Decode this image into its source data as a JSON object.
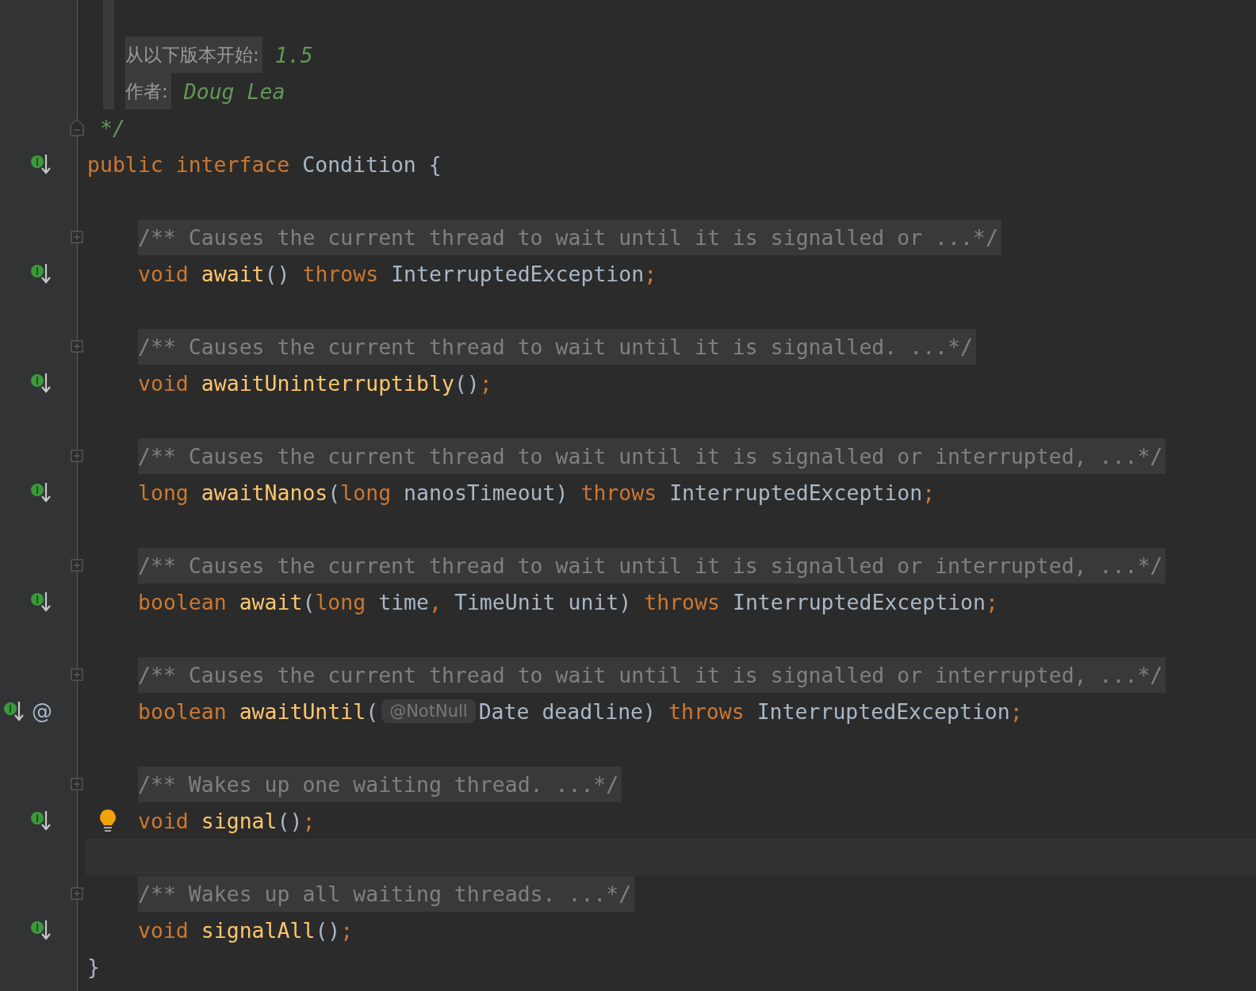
{
  "editor": {
    "lines": [
      {
        "kind": "doc"
      },
      {
        "kind": "doc",
        "label": "从以下版本开始:",
        "value": "1.5"
      },
      {
        "kind": "doc",
        "label": "作者:",
        "value": "Doug Lea"
      },
      {
        "kind": "doc_close",
        "text": "*/",
        "fold_end": true
      },
      {
        "kind": "code",
        "implements": true,
        "tokens": [
          {
            "kind": "keyword",
            "text": "public "
          },
          {
            "kind": "keyword",
            "text": "interface "
          },
          {
            "kind": "plain",
            "text": "Condition {"
          }
        ],
        "children": [
          {
            "kind": "blank"
          },
          {
            "kind": "comment",
            "text": "/** Causes the current thread to wait until it is signalled or ...*/",
            "folded": true
          },
          {
            "kind": "code",
            "implements": true,
            "tokens": [
              {
                "kind": "keyword",
                "text": "void "
              },
              {
                "kind": "method",
                "text": "await"
              },
              {
                "kind": "plain",
                "text": "() "
              },
              {
                "kind": "keyword",
                "text": "throws "
              },
              {
                "kind": "plain",
                "text": "InterruptedException"
              },
              {
                "kind": "keyword",
                "text": ";"
              }
            ]
          },
          {
            "kind": "blank"
          },
          {
            "kind": "comment",
            "text": "/** Causes the current thread to wait until it is signalled. ...*/",
            "folded": true
          },
          {
            "kind": "code",
            "implements": true,
            "tokens": [
              {
                "kind": "keyword",
                "text": "void "
              },
              {
                "kind": "method",
                "text": "awaitUninterruptibly"
              },
              {
                "kind": "plain",
                "text": "()"
              },
              {
                "kind": "keyword",
                "text": ";"
              }
            ]
          },
          {
            "kind": "blank"
          },
          {
            "kind": "comment",
            "text": "/** Causes the current thread to wait until it is signalled or interrupted, ...*/",
            "folded": true
          },
          {
            "kind": "code",
            "implements": true,
            "tokens": [
              {
                "kind": "keyword",
                "text": "long "
              },
              {
                "kind": "method",
                "text": "awaitNanos"
              },
              {
                "kind": "plain",
                "text": "("
              },
              {
                "kind": "keyword",
                "text": "long "
              },
              {
                "kind": "plain",
                "text": "nanosTimeout) "
              },
              {
                "kind": "keyword",
                "text": "throws "
              },
              {
                "kind": "plain",
                "text": "InterruptedException"
              },
              {
                "kind": "keyword",
                "text": ";"
              }
            ]
          },
          {
            "kind": "blank"
          },
          {
            "kind": "comment",
            "text": "/** Causes the current thread to wait until it is signalled or interrupted, ...*/",
            "folded": true
          },
          {
            "kind": "code",
            "implements": true,
            "tokens": [
              {
                "kind": "keyword",
                "text": "boolean "
              },
              {
                "kind": "method",
                "text": "await"
              },
              {
                "kind": "plain",
                "text": "("
              },
              {
                "kind": "keyword",
                "text": "long "
              },
              {
                "kind": "plain",
                "text": "time"
              },
              {
                "kind": "keyword",
                "text": ", "
              },
              {
                "kind": "plain",
                "text": "TimeUnit unit) "
              },
              {
                "kind": "keyword",
                "text": "throws "
              },
              {
                "kind": "plain",
                "text": "InterruptedException"
              },
              {
                "kind": "keyword",
                "text": ";"
              }
            ]
          },
          {
            "kind": "blank"
          },
          {
            "kind": "comment",
            "text": "/** Causes the current thread to wait until it is signalled or interrupted, ...*/",
            "folded": true
          },
          {
            "kind": "code",
            "implements": true,
            "gutter_mark": "@",
            "tokens": [
              {
                "kind": "keyword",
                "text": "boolean "
              },
              {
                "kind": "method",
                "text": "awaitUntil"
              },
              {
                "kind": "plain",
                "text": "("
              }
            ],
            "hint": "@NotNull",
            "tokens_after": [
              {
                "kind": "plain",
                "text": "Date deadline) "
              },
              {
                "kind": "keyword",
                "text": "throws "
              },
              {
                "kind": "plain",
                "text": "InterruptedException"
              },
              {
                "kind": "keyword",
                "text": ";"
              }
            ]
          },
          {
            "kind": "blank"
          },
          {
            "kind": "comment",
            "text": "/** Wakes up one waiting thread. ...*/",
            "folded": true
          },
          {
            "kind": "code",
            "implements": true,
            "bulb": true,
            "tokens": [
              {
                "kind": "keyword",
                "text": "void "
              },
              {
                "kind": "method",
                "text": "signal"
              },
              {
                "kind": "plain",
                "text": "()"
              },
              {
                "kind": "keyword",
                "text": ";"
              }
            ]
          },
          {
            "kind": "blank",
            "current": true
          },
          {
            "kind": "comment",
            "text": "/** Wakes up all waiting threads. ...*/",
            "folded": true
          },
          {
            "kind": "code",
            "implements": true,
            "tokens": [
              {
                "kind": "keyword",
                "text": "void "
              },
              {
                "kind": "method",
                "text": "signalAll"
              },
              {
                "kind": "plain",
                "text": "()"
              },
              {
                "kind": "keyword",
                "text": ";"
              }
            ]
          }
        ]
      },
      {
        "kind": "code",
        "tokens": [
          {
            "kind": "plain",
            "text": "}"
          }
        ]
      }
    ]
  }
}
